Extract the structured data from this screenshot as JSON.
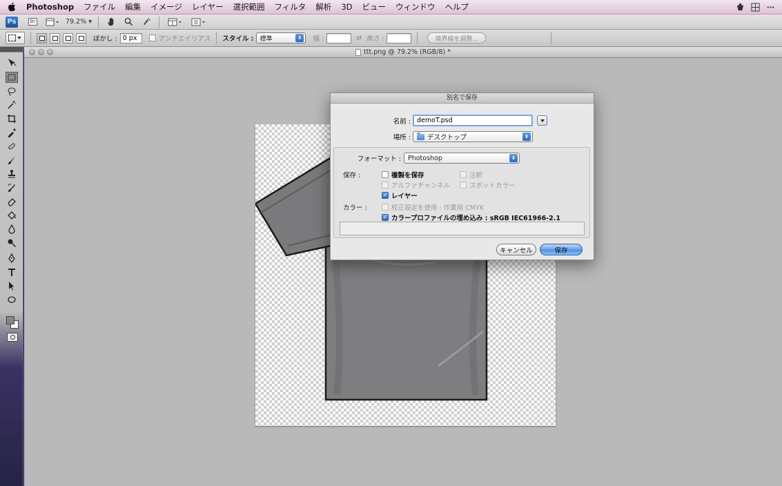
{
  "menubar": {
    "app_name": "Photoshop",
    "items": [
      "ファイル",
      "編集",
      "イメージ",
      "レイヤー",
      "選択範囲",
      "フィルタ",
      "解析",
      "3D",
      "ビュー",
      "ウィンドウ",
      "ヘルプ"
    ],
    "extras": [
      "ime-icon",
      "grid-icon",
      "more-icon"
    ]
  },
  "appbar": {
    "logo": "Ps",
    "bridge": "Br",
    "zoom": "79.2% ▾"
  },
  "optionsbar": {
    "feather_label": "ぼかし :",
    "feather_value": "0 px",
    "antialias_label": "アンチエイリアス",
    "style_label": "スタイル :",
    "style_value": "標準",
    "width_label": "幅 :",
    "height_label": "高さ :",
    "refine_edge": "境界線を調整..."
  },
  "document": {
    "title": "ttt.png @ 79.2% (RGB/8) *"
  },
  "save_dialog": {
    "title": "別名で保存",
    "name_label": "名前 :",
    "name_value": "demoT.psd",
    "location_label": "場所 :",
    "location_value": "デスクトップ",
    "format_label": "フォーマット :",
    "format_value": "Photoshop",
    "save_label": "保存 :",
    "color_label": "カラー :",
    "options": {
      "save_copy": "複製を保存",
      "annotations": "注釈",
      "alpha_channels": "アルファチャンネル",
      "spot_colors": "スポットカラー",
      "layers": "レイヤー",
      "proof_setup": "校正設定を使用 : 作業用 CMYK",
      "icc_profile": "カラープロファイルの埋め込み : sRGB IEC61966-2.1"
    },
    "cancel_button": "キャンセル",
    "save_button": "保存"
  }
}
